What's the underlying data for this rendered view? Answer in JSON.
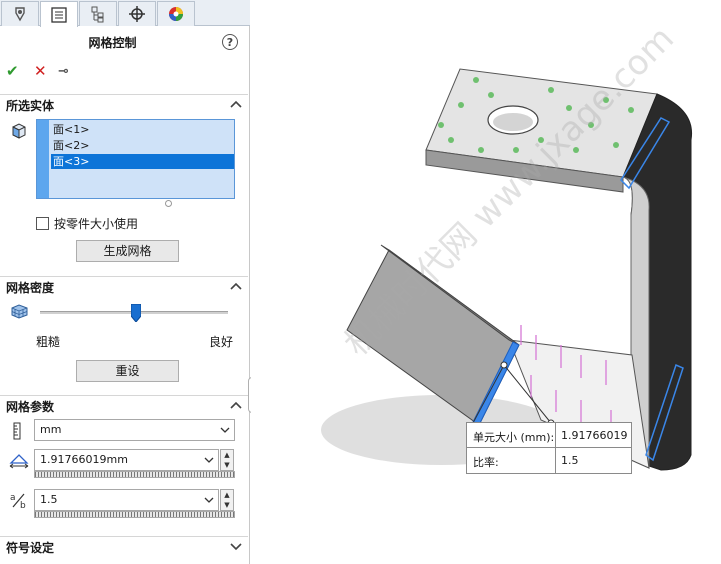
{
  "tabs": [
    {
      "icon": "feature-manager-icon"
    },
    {
      "icon": "property-manager-icon",
      "active": true
    },
    {
      "icon": "configuration-manager-icon"
    },
    {
      "icon": "dimxpert-icon"
    },
    {
      "icon": "display-manager-icon"
    }
  ],
  "panel": {
    "title": "网格控制",
    "help": "?"
  },
  "selected_entities": {
    "header": "所选实体",
    "items": [
      "面<1>",
      "面<2>",
      "面<3>"
    ],
    "selected_index": 2,
    "use_part_size_label": "按零件大小使用",
    "use_part_size_checked": false,
    "generate_button": "生成网格"
  },
  "mesh_density": {
    "header": "网格密度",
    "coarse_label": "粗糙",
    "fine_label": "良好",
    "slider_level": 0.5,
    "reset_button": "重设"
  },
  "mesh_parameters": {
    "header": "网格参数",
    "unit": "mm",
    "element_size": "1.91766019mm",
    "ratio": "1.5"
  },
  "symbol_settings": {
    "header": "符号设定"
  },
  "callout": {
    "size_label": "单元大小 (mm):",
    "size_value": "1.91766019",
    "ratio_label": "比率:",
    "ratio_value": "1.5"
  },
  "watermark": "机械时代网 www.jxage.com",
  "colors": {
    "selection_blue": "#0d74d8",
    "list_bg": "#cfe2f8",
    "ok_green": "#2f9a2f",
    "cancel_red": "#d02020",
    "face_highlight": "#3a86e8"
  }
}
